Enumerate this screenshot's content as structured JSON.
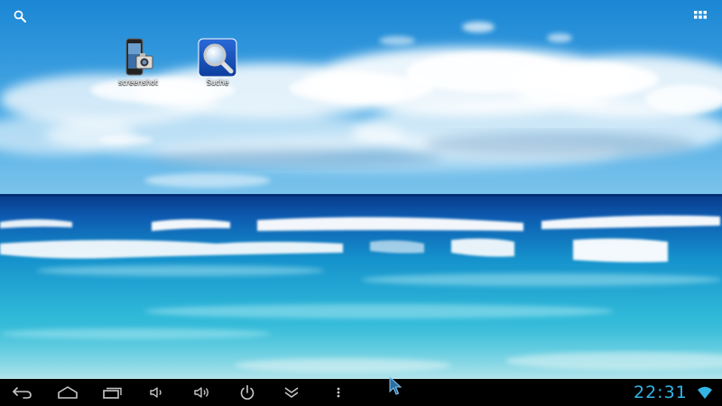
{
  "desktop": {
    "top_left_icon": "search-icon",
    "top_right_icon": "all-apps-grid-icon",
    "shortcuts": [
      {
        "label": "screenshot",
        "icon": "screenshot-phone-camera-icon"
      },
      {
        "label": "Suche",
        "icon": "magnifier-search-icon"
      }
    ]
  },
  "navbar": {
    "buttons": [
      {
        "name": "back",
        "icon": "back-arrow-icon"
      },
      {
        "name": "home",
        "icon": "home-icon"
      },
      {
        "name": "recent-apps",
        "icon": "recent-apps-icon"
      },
      {
        "name": "volume-down",
        "icon": "volume-down-icon"
      },
      {
        "name": "volume-up",
        "icon": "volume-up-icon"
      },
      {
        "name": "power",
        "icon": "power-icon"
      },
      {
        "name": "hide-bar",
        "icon": "chevron-down-double-icon"
      },
      {
        "name": "menu",
        "icon": "overflow-menu-icon"
      }
    ],
    "clock": "22:31",
    "status_icon": "wifi-icon",
    "accent_color": "#33b5e5"
  },
  "colors": {
    "sky_top": "#1c8fd8",
    "sky_horizon": "#6cc0ee",
    "sea_deep": "#0a3f8f",
    "sea_shallow": "#35c3dc",
    "navbar_bg": "#000000"
  }
}
